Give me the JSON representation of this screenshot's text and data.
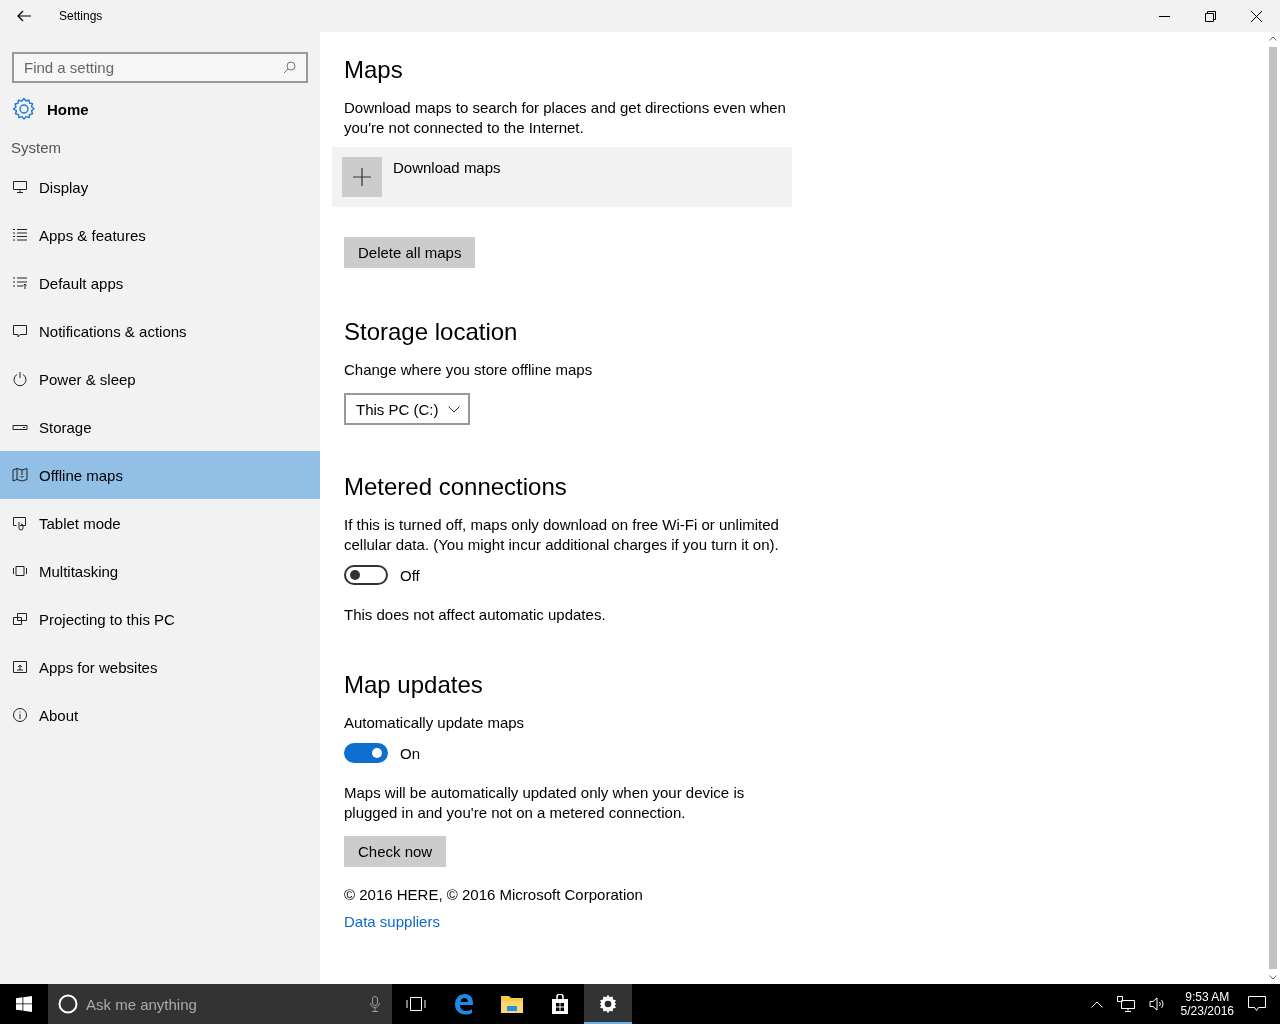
{
  "window": {
    "title": "Settings"
  },
  "sidebar": {
    "search": {
      "placeholder": "Find a setting"
    },
    "home": "Home",
    "section": "System",
    "items": [
      {
        "label": "Display",
        "selected": false
      },
      {
        "label": "Apps & features",
        "selected": false
      },
      {
        "label": "Default apps",
        "selected": false
      },
      {
        "label": "Notifications & actions",
        "selected": false
      },
      {
        "label": "Power & sleep",
        "selected": false
      },
      {
        "label": "Storage",
        "selected": false
      },
      {
        "label": "Offline maps",
        "selected": true
      },
      {
        "label": "Tablet mode",
        "selected": false
      },
      {
        "label": "Multitasking",
        "selected": false
      },
      {
        "label": "Projecting to this PC",
        "selected": false
      },
      {
        "label": "Apps for websites",
        "selected": false
      },
      {
        "label": "About",
        "selected": false
      }
    ]
  },
  "content": {
    "maps": {
      "title": "Maps",
      "description": "Download maps to search for places and get directions even when you're not connected to the Internet.",
      "download": "Download maps",
      "delete_button": "Delete all maps"
    },
    "storage": {
      "title": "Storage location",
      "label": "Change where you store offline maps",
      "dropdown": "This PC (C:)"
    },
    "metered": {
      "title": "Metered connections",
      "description": "If this is turned off, maps only download on free Wi-Fi or unlimited cellular data. (You might incur additional charges if you turn it on).",
      "toggle": {
        "on": false,
        "label": "Off"
      },
      "note": "This does not affect automatic updates."
    },
    "updates": {
      "title": "Map updates",
      "label": "Automatically update maps",
      "toggle": {
        "on": true,
        "label": "On"
      },
      "description": "Maps will be automatically updated only when your device is plugged in and you're not on a metered connection.",
      "button": "Check now"
    },
    "copyright": "© 2016 HERE, © 2016 Microsoft Corporation",
    "link": "Data suppliers"
  },
  "taskbar": {
    "search_placeholder": "Ask me anything",
    "time": "9:53 AM",
    "date": "5/23/2016"
  }
}
